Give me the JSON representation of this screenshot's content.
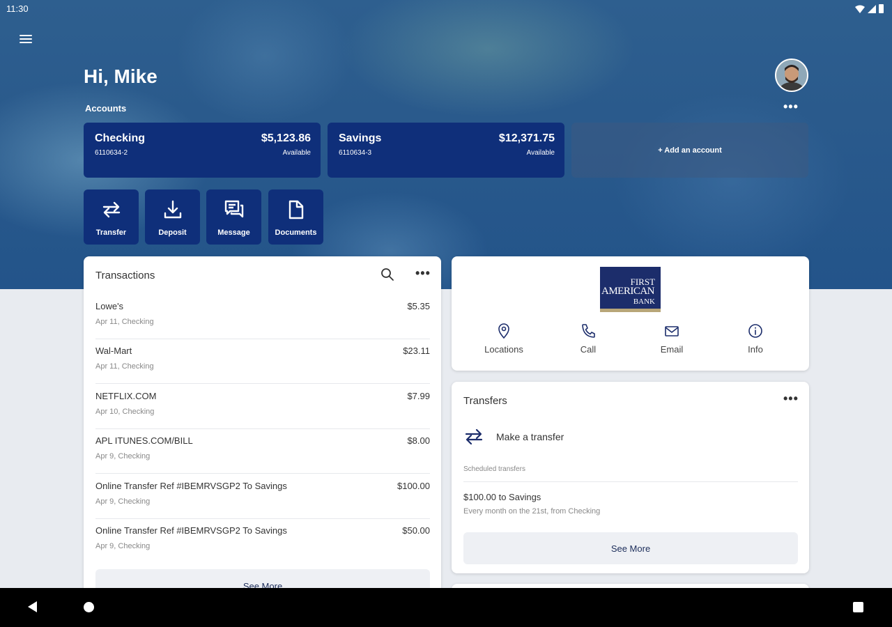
{
  "status": {
    "time": "11:30"
  },
  "header": {
    "greeting": "Hi, Mike",
    "accounts_label": "Accounts",
    "more": "•••"
  },
  "accounts": [
    {
      "name": "Checking",
      "number": "6110634-2",
      "balance": "$5,123.86",
      "balance_label": "Available"
    },
    {
      "name": "Savings",
      "number": "6110634-3",
      "balance": "$12,371.75",
      "balance_label": "Available"
    }
  ],
  "add_account_label": "+ Add an account",
  "actions": [
    {
      "label": "Transfer",
      "icon": "transfer-icon"
    },
    {
      "label": "Deposit",
      "icon": "deposit-icon"
    },
    {
      "label": "Message",
      "icon": "message-icon"
    },
    {
      "label": "Documents",
      "icon": "document-icon"
    }
  ],
  "transactions": {
    "title": "Transactions",
    "more": "•••",
    "rows": [
      {
        "name": "Lowe's",
        "sub": "Apr 11, Checking",
        "amount": "$5.35"
      },
      {
        "name": "Wal-Mart",
        "sub": "Apr 11, Checking",
        "amount": "$23.11"
      },
      {
        "name": "NETFLIX.COM",
        "sub": "Apr 10, Checking",
        "amount": "$7.99"
      },
      {
        "name": "APL ITUNES.COM/BILL",
        "sub": "Apr 9, Checking",
        "amount": "$8.00"
      },
      {
        "name": "Online Transfer Ref #IBEMRVSGP2 To Savings",
        "sub": "Apr 9, Checking",
        "amount": "$100.00"
      },
      {
        "name": "Online Transfer Ref #IBEMRVSGP2 To Savings",
        "sub": "Apr 9, Checking",
        "amount": "$50.00"
      }
    ],
    "see_more": "See More"
  },
  "bank": {
    "logo_line1": "FIRST",
    "logo_line2": "AMERICAN",
    "logo_line3": "BANK",
    "actions": [
      {
        "label": "Locations",
        "icon": "location-pin-icon"
      },
      {
        "label": "Call",
        "icon": "phone-icon"
      },
      {
        "label": "Email",
        "icon": "email-icon"
      },
      {
        "label": "Info",
        "icon": "info-icon"
      }
    ]
  },
  "transfers": {
    "title": "Transfers",
    "more": "•••",
    "make_label": "Make a transfer",
    "scheduled_label": "Scheduled transfers",
    "scheduled_item_title": "$100.00 to Savings",
    "scheduled_item_sub": "Every month on the 21st, from Checking",
    "see_more": "See More"
  },
  "colors": {
    "primary": "#0f2f7a",
    "background": "#e8ebf0",
    "card": "#ffffff"
  }
}
